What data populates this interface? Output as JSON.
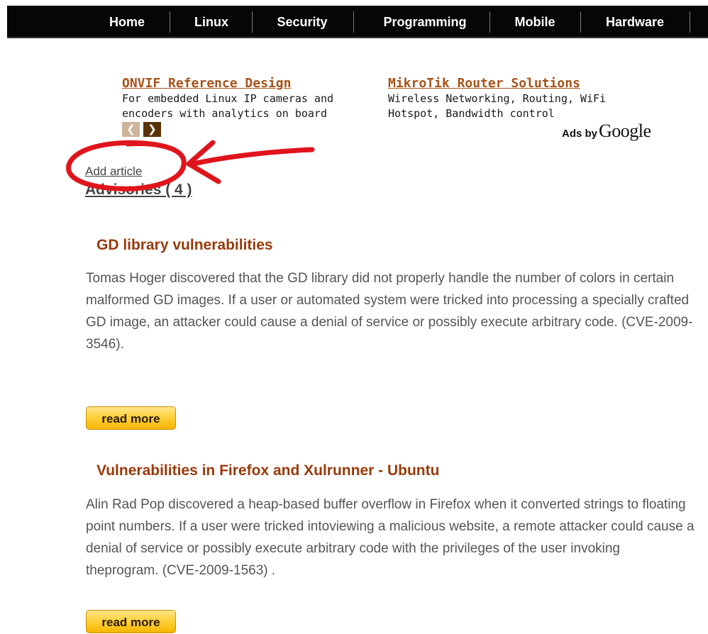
{
  "nav": {
    "items": [
      {
        "label": "Home"
      },
      {
        "label": "Linux"
      },
      {
        "label": "Security"
      },
      {
        "label": "Programming"
      },
      {
        "label": "Mobile"
      },
      {
        "label": "Hardware"
      }
    ]
  },
  "ads": {
    "items": [
      {
        "title": "ONVIF Reference Design",
        "text": "For embedded Linux IP cameras and encoders with analytics on board"
      },
      {
        "title": "MikroTik Router Solutions",
        "text": "Wireless Networking, Routing, WiFi Hotspot, Bandwidth control"
      }
    ],
    "prev_icon": "chevron-left-icon",
    "next_icon": "chevron-right-icon",
    "ads_by_label": "Ads by",
    "google_label": "Google"
  },
  "annotation": {
    "color": "#e0141c",
    "shape": "circle-and-arrow"
  },
  "content": {
    "add_article": "Add article",
    "section_title": "Advisories ( 4 )",
    "articles": [
      {
        "title": "GD library vulnerabilities",
        "body": "Tomas Hoger discovered that the GD library did not properly handle the number of colors in certain malformed GD images. If a user or automated system were tricked into processing a specially crafted GD image, an attacker could cause a denial of service or possibly execute arbitrary code. (CVE-2009-3546).",
        "read_more": "read more"
      },
      {
        "title": "Vulnerabilities in Firefox and Xulrunner - Ubuntu",
        "body": "Alin Rad Pop discovered a heap-based buffer overflow in Firefox when it converted strings to floating point numbers. If a user were tricked intoviewing a malicious website, a remote attacker could cause a denial of service or possibly execute arbitrary code with the privileges of the user invoking theprogram. (CVE-2009-1563) .",
        "read_more": "read more"
      }
    ]
  },
  "colors": {
    "nav_bg": "#060606",
    "ad_title": "#a8521a",
    "article_title": "#993a0a",
    "button": "#ffd23d"
  }
}
